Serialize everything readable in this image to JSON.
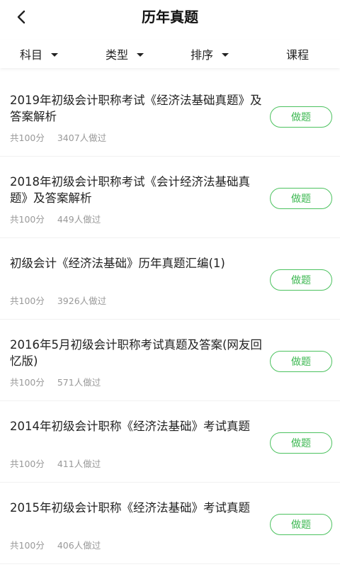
{
  "header": {
    "title": "历年真题"
  },
  "filters": {
    "subject": "科目",
    "type": "类型",
    "sort": "排序",
    "course": "课程"
  },
  "items": [
    {
      "title": "2019年初级会计职称考试《经济法基础真题》及答案解析",
      "score": "共100分",
      "count": "3407人做过",
      "button": "做题"
    },
    {
      "title": "2018年初级会计职称考试《会计经济法基础真题》及答案解析",
      "score": "共100分",
      "count": "449人做过",
      "button": "做题"
    },
    {
      "title": "初级会计《经济法基础》历年真题汇编(1)",
      "score": "共100分",
      "count": "3926人做过",
      "button": "做题"
    },
    {
      "title": "2016年5月初级会计职称考试真题及答案(网友回忆版)",
      "score": "共100分",
      "count": "571人做过",
      "button": "做题"
    },
    {
      "title": "2014年初级会计职称《经济法基础》考试真题",
      "score": "共100分",
      "count": "411人做过",
      "button": "做题"
    },
    {
      "title": "2015年初级会计职称《经济法基础》考试真题",
      "score": "共100分",
      "count": "406人做过",
      "button": "做题"
    }
  ]
}
